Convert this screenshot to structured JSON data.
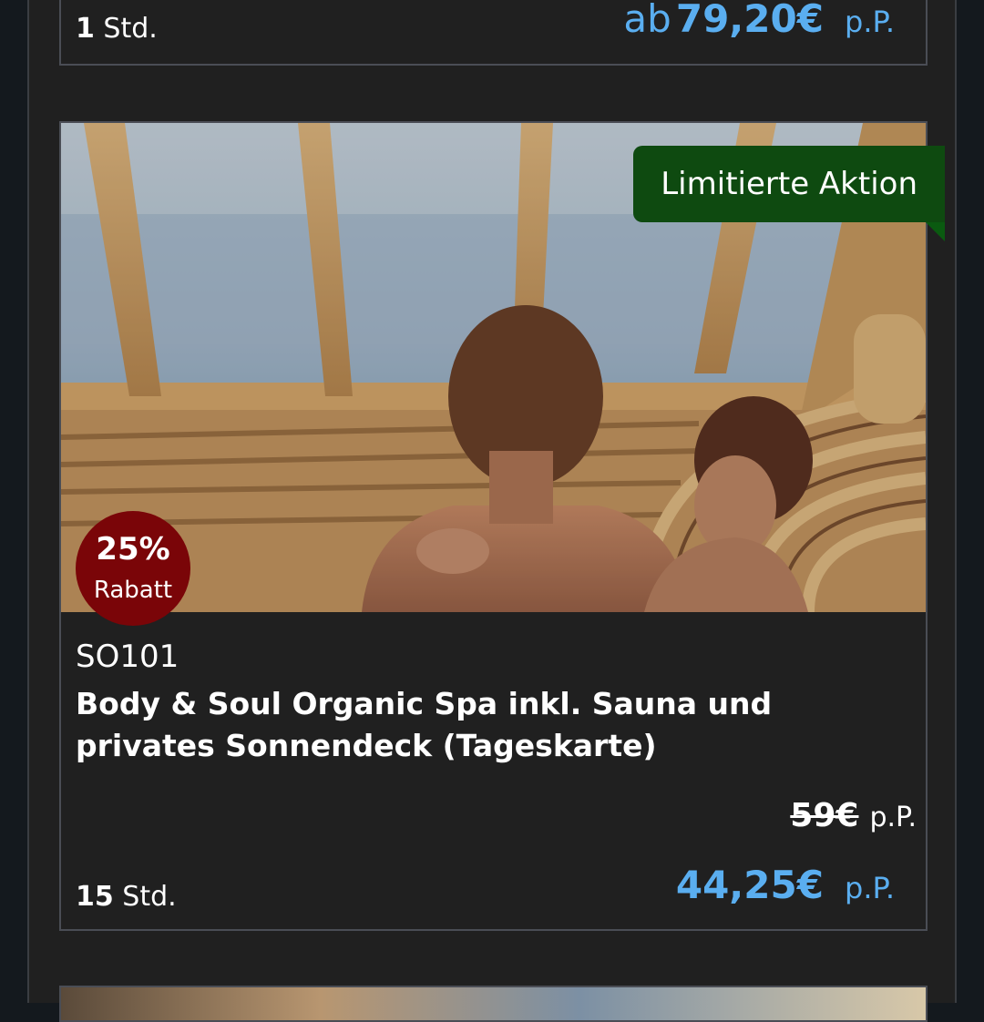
{
  "top_card": {
    "duration_num": "1",
    "duration_unit": "Std.",
    "price_prefix": "ab",
    "price": "79,20€",
    "per_person": "p.P."
  },
  "main_card": {
    "ribbon_label": "Limitierte Aktion",
    "discount_percent": "25%",
    "discount_label": "Rabatt",
    "code": "SO101",
    "title": "Body & Soul Organic Spa inkl. Sauna und privates Sonnendeck (Tageskarte)",
    "old_price": "59€",
    "old_per_person": "p.P.",
    "duration_num": "15",
    "duration_unit": "Std.",
    "price": "44,25€",
    "per_person": "p.P."
  },
  "colors": {
    "accent_blue": "#5aaef0",
    "ribbon_green": "#0e4a10",
    "discount_red": "#7a0508",
    "background": "#202020"
  }
}
